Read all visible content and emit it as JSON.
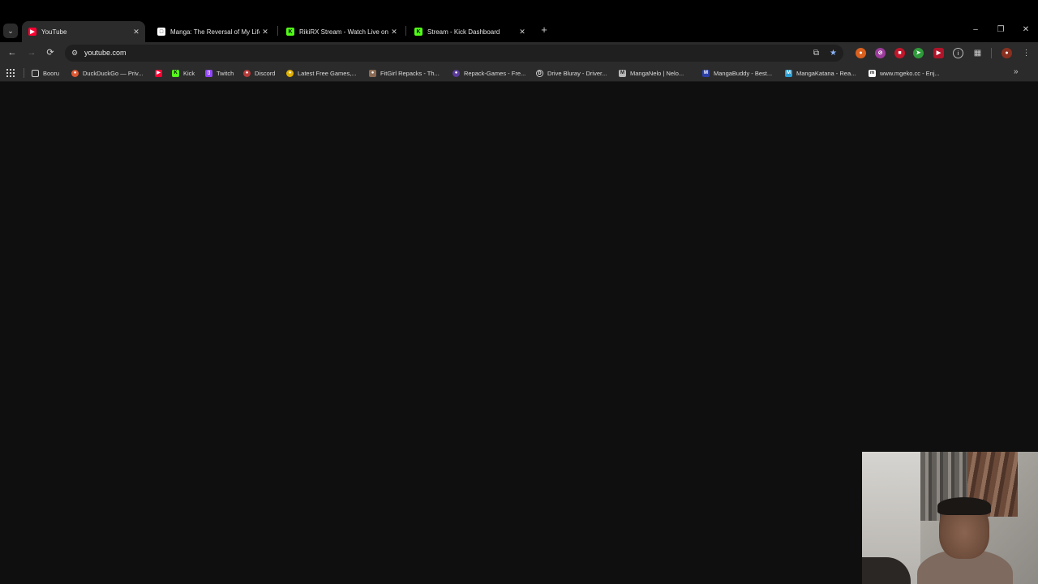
{
  "browser": {
    "tabs": [
      {
        "title": "YouTube",
        "active": true,
        "favicon": "youtube-icon",
        "color": "#ff0033"
      },
      {
        "title": "Manga: The Reversal of My Life",
        "active": false,
        "favicon": "manga-icon",
        "color": "#ffffff"
      },
      {
        "title": "RikiRX Stream - Watch Live on K",
        "active": false,
        "favicon": "kick-icon",
        "color": "#53fc18"
      },
      {
        "title": "Stream - Kick Dashboard",
        "active": false,
        "favicon": "kick-icon",
        "color": "#53fc18"
      }
    ],
    "address": {
      "url": "youtube.com"
    },
    "bookmarks": [
      {
        "label": "Booru",
        "icon": "folder-icon"
      },
      {
        "label": "DuckDuckGo — Priv...",
        "icon": "duckduckgo-icon"
      },
      {
        "label": "",
        "icon": "youtube-icon"
      },
      {
        "label": "Kick",
        "icon": "kick-icon"
      },
      {
        "label": "Twitch",
        "icon": "twitch-icon"
      },
      {
        "label": "Discord",
        "icon": "discord-icon"
      },
      {
        "label": "Latest Free Games,...",
        "icon": "free-games-icon"
      },
      {
        "label": "FitGirl Repacks - Th...",
        "icon": "fitgirl-icon"
      },
      {
        "label": "Repack-Games - Fre...",
        "icon": "repack-games-icon"
      },
      {
        "label": "Drive Bluray - Driver...",
        "icon": "drive-bluray-icon"
      },
      {
        "label": "MangaNelo | Nelo...",
        "icon": "manganelo-icon"
      },
      {
        "label": "MangaBuddy - Best...",
        "icon": "mangabuddy-icon"
      },
      {
        "label": "MangaKatana - Rea...",
        "icon": "mangakatana-icon"
      },
      {
        "label": "www.mgeko.cc - Enj...",
        "icon": "mgeko-icon"
      }
    ]
  },
  "colors": {
    "accent": "#8ab4f8",
    "background": "#0f0f0f",
    "toolbar": "#2b2b2b"
  }
}
